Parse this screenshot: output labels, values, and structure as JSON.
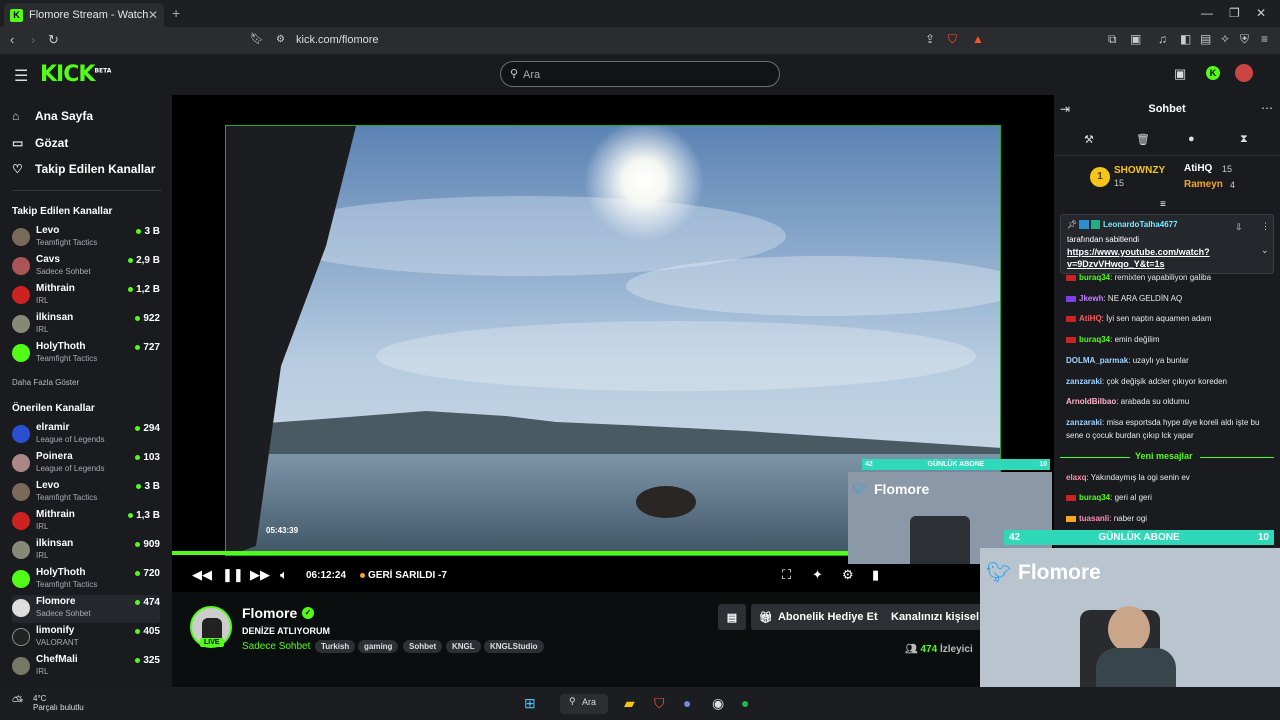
{
  "browser": {
    "tab_title": "Flomore Stream - Watch Live",
    "url": "kick.com/flomore"
  },
  "header": {
    "logo": "KICK",
    "logo_sup": "BETA",
    "search_placeholder": "Ara"
  },
  "sidebar": {
    "nav": [
      "Ana Sayfa",
      "Gözat",
      "Takip Edilen Kanallar"
    ],
    "followed_title": "Takip Edilen Kanallar",
    "followed": [
      {
        "name": "Levo",
        "category": "Teamfight Tactics",
        "viewers": "3 B"
      },
      {
        "name": "Cavs",
        "category": "Sadece Sohbet",
        "viewers": "2,9 B"
      },
      {
        "name": "Mithrain",
        "category": "IRL",
        "viewers": "1,2 B"
      },
      {
        "name": "ilkinsan",
        "category": "IRL",
        "viewers": "922"
      },
      {
        "name": "HolyThoth",
        "category": "Teamfight Tactics",
        "viewers": "727"
      }
    ],
    "show_more": "Daha Fazla Göster",
    "recommended_title": "Önerilen Kanallar",
    "recommended": [
      {
        "name": "elramir",
        "category": "League of Legends",
        "viewers": "294"
      },
      {
        "name": "Poinera",
        "category": "League of Legends",
        "viewers": "103"
      },
      {
        "name": "Levo",
        "category": "Teamfight Tactics",
        "viewers": "3 B"
      },
      {
        "name": "Mithrain",
        "category": "IRL",
        "viewers": "1,3 B"
      },
      {
        "name": "ilkinsan",
        "category": "IRL",
        "viewers": "909"
      },
      {
        "name": "HolyThoth",
        "category": "Teamfight Tactics",
        "viewers": "720"
      },
      {
        "name": "Flomore",
        "category": "Sadece Sohbet",
        "viewers": "474"
      },
      {
        "name": "limonify",
        "category": "VALORANT",
        "viewers": "405"
      },
      {
        "name": "ChefMali",
        "category": "IRL",
        "viewers": "325"
      }
    ]
  },
  "player": {
    "hover_time": "05:43:39",
    "timecode": "06:12:24",
    "behind": "GERİ SARILDI -7",
    "progress": 0.97
  },
  "stream": {
    "name": "Flomore",
    "title": "DENİZE ATLIYORUM",
    "category": "Sadece Sohbet",
    "tags": [
      "Turkish",
      "gaming",
      "Sohbet",
      "KNGL",
      "KNGLStudio"
    ],
    "live_label": "LIVE",
    "gift_button": "Abonelik Hediye Et",
    "customize_button": "Kanalınızı kişisel",
    "viewers": "474",
    "viewers_label": "İzleyici"
  },
  "chat": {
    "title": "Sohbet",
    "gifters": {
      "rank": "1",
      "top_name": "SHOWNZY",
      "top_count": "15",
      "second_name": "AtiHQ",
      "second_count": "15",
      "third_name": "Rameyn",
      "third_count": "4"
    },
    "pinned": {
      "user": "LeonardoTalha4677",
      "by": "tarafından sabitlendi",
      "link": "https://www.youtube.com/watch?v=9DzvVHwqo_Y&t=1s"
    },
    "messages_top": [
      {
        "user": "buraq34",
        "color": "#53fc18",
        "text": "remixten yapabiliyon galiba"
      },
      {
        "user": "Jkewh",
        "color": "#c77dff",
        "text": "NE ARA GELDİN AQ"
      },
      {
        "user": "AtiHQ",
        "color": "#ff5c5c",
        "text": "İyi sen naptın aquamen adam"
      },
      {
        "user": "buraq34",
        "color": "#53fc18",
        "text": "emin değilim"
      },
      {
        "user": "DOLMA_parmak",
        "color": "#9fd3ff",
        "text": "uzaylı ya bunlar"
      },
      {
        "user": "zanzaraki",
        "color": "#9fd3ff",
        "text": "çok değişik adcler çıkıyor koreden"
      },
      {
        "user": "ArnoldBilbao",
        "color": "#ffb3c7",
        "text": "arabada su oldumu"
      },
      {
        "user": "zanzaraki",
        "color": "#9fd3ff",
        "text": "misa esportsda hype diye koreli aldı işte bu sene o çocuk burdan çıkıp lck yapar"
      }
    ],
    "new_messages_label": "Yeni mesajlar",
    "messages_bottom": [
      {
        "user": "elaxq",
        "color": "#ff8fb1",
        "text": "Yakındaymış la ogi senin ev"
      },
      {
        "user": "buraq34",
        "color": "#53fc18",
        "text": "geri al geri"
      },
      {
        "user": "tuasanli",
        "color": "#ff8fb1",
        "text": "naber ogi"
      }
    ]
  },
  "overlay": {
    "small_sub_left": "42",
    "small_sub_label": "GÜNLÜK ABONE",
    "small_sub_right": "10",
    "small_cam_name": "Flomore",
    "big_sub_left": "42",
    "big_sub_label": "GÜNLÜK ABONE",
    "big_sub_right": "10",
    "big_cam_name": "Flomore"
  },
  "taskbar": {
    "temp": "4°C",
    "weather": "Parçalı bulutlu",
    "search": "Ara"
  },
  "colors": {
    "kick_green": "#53fc18",
    "sub_bar": "#2fd8b9"
  }
}
